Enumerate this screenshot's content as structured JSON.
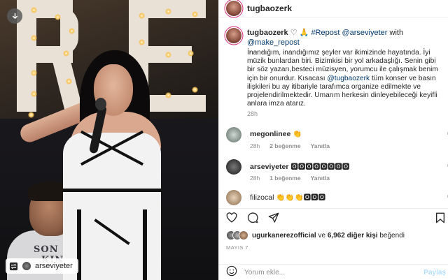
{
  "post": {
    "author": "tugbaozerk",
    "reposted_from": "arseviyeter"
  },
  "caption": {
    "username": "tugbaozerk",
    "symbols": "♡ 🙏",
    "hashtag": "#Repost",
    "mention1": "@arseviyeter",
    "with_word": "with",
    "mention2": "@make_repost",
    "dots": "・・・",
    "text_before_mention": "İnandığım, inandığımız şeyler var ikimizinde hayatında. İyi müzik bunlardan biri. Bizimkisi bir yol arkadaşlığı. Senin gibi bir söz yazarı,besteci müzisyen, yorumcu ile çalışmak benim için bir onurdur. Kısacası ",
    "inline_mention": "@tugbaozerk",
    "text_after_mention": " tüm konser ve basın ilişkileri bu ay itibariyle tarafımca organize edilmekte ve projelendirilmektedir. Umarım herkesin dinleyebileceği keyifli anlara imza atarız.",
    "time": "28h"
  },
  "comments": [
    {
      "username": "megonlinee",
      "emoji": "👏",
      "time": "28h",
      "likes": "2 beğenme",
      "reply": "Yanıtla"
    },
    {
      "username": "arseviyeter",
      "emoji": "🅾🅾🅾🅾🅾🅾🅾🅾",
      "time": "28h",
      "likes": "1 beğenme",
      "reply": "Yanıtla"
    },
    {
      "username": "filizocal",
      "emoji": "👏👏👏🅾🅾🅾",
      "time": "",
      "likes": "",
      "reply": ""
    }
  ],
  "likes_summary": {
    "liker": "ugurkanerezofficial",
    "joiner": "ve",
    "others": "6,962 diğer kişi",
    "suffix": "beğendi"
  },
  "date": "MAYIS 7",
  "comment_box": {
    "placeholder": "Yorum ekle...",
    "post_label": "Paylaş"
  },
  "icons": {
    "download": "download-icon",
    "repost": "repost-icon",
    "heart": "heart-icon",
    "comment": "comment-icon",
    "share": "share-icon",
    "save": "save-icon",
    "emoji": "emoji-icon"
  },
  "colors": {
    "link": "#00376b",
    "muted": "#8e8e8e",
    "story_ring": "#d62976",
    "post_disabled": "#b2dffc"
  }
}
